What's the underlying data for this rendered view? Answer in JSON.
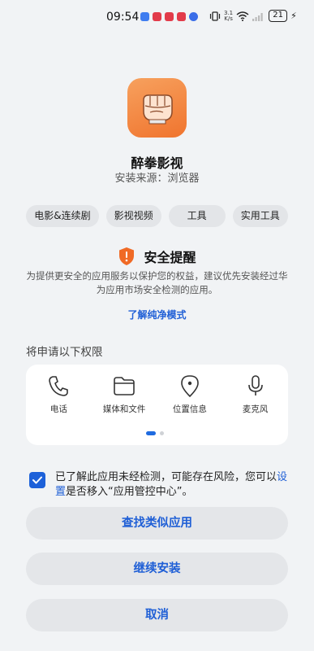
{
  "status_bar": {
    "time": "09:54",
    "net_speed_value": "3.1",
    "net_speed_unit": "K/s",
    "battery": "21"
  },
  "app": {
    "name": "醉拳影视",
    "source": "安装来源：浏览器",
    "icon_color": "#f58a45"
  },
  "tags": [
    "电影&连续剧",
    "影视视频",
    "工具",
    "实用工具"
  ],
  "security": {
    "title": "安全提醒",
    "description": "为提供更安全的应用服务以保护您的权益，建议优先安装经过华为应用市场安全检测的应用。",
    "learn_more": "了解纯净模式"
  },
  "permissions": {
    "heading": "将申请以下权限",
    "items": [
      {
        "label": "电话",
        "icon": "phone-icon"
      },
      {
        "label": "媒体和文件",
        "icon": "folder-icon"
      },
      {
        "label": "位置信息",
        "icon": "location-icon"
      },
      {
        "label": "麦克风",
        "icon": "microphone-icon"
      }
    ]
  },
  "acknowledge": {
    "checked": true,
    "text_before": "已了解此应用未经检测，可能存在风险，您可以",
    "link": "设置",
    "text_after": "是否移入“应用管控中心”。"
  },
  "buttons": {
    "find_similar": "查找类似应用",
    "continue_install": "继续安装",
    "cancel": "取消"
  },
  "colors": {
    "accent": "#1f5fd6",
    "warning": "#f06a25"
  }
}
